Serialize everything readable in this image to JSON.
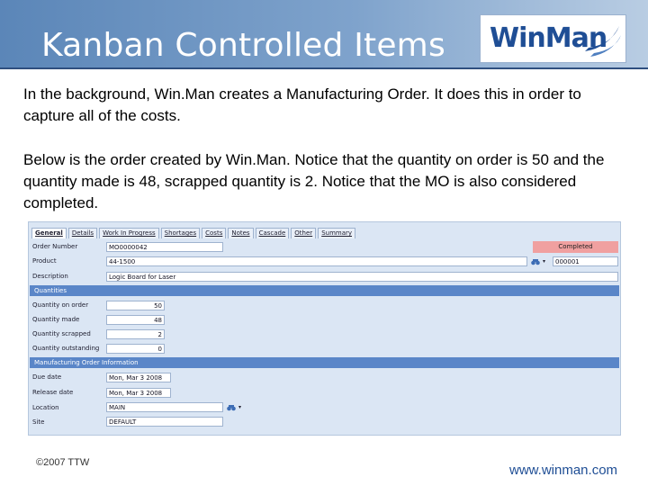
{
  "slide": {
    "title": "Kanban Controlled Items",
    "logo_text": "WinMan",
    "paragraph1": "In the background, Win.Man creates a Manufacturing Order.  It does this in order to capture all of the costs.",
    "paragraph2": "Below is the order created by Win.Man.  Notice that the quantity on order is 50 and the quantity made is 48, scrapped quantity is 2.  Notice that the MO is also considered completed.",
    "footer_left": "©2007 TTW",
    "footer_right": "www.winman.com",
    "colors": {
      "header": "#5b86b8",
      "section_bar": "#5a86c8",
      "status_badge": "#f0a0a0",
      "link": "#1f4e95"
    }
  },
  "mo_form": {
    "tabs": [
      "General",
      "Details",
      "Work In Progress",
      "Shortages",
      "Costs",
      "Notes",
      "Cascade",
      "Other",
      "Summary"
    ],
    "order_number_label": "Order Number",
    "order_number": "MO0000042",
    "status": "Completed",
    "product_label": "Product",
    "product": "44-1500",
    "product_code": "000001",
    "description_label": "Description",
    "description": "Logic Board for Laser",
    "quantities_section": "Quantities",
    "qty_on_order_label": "Quantity on order",
    "qty_on_order": "50",
    "qty_made_label": "Quantity made",
    "qty_made": "48",
    "qty_scrapped_label": "Quantity scrapped",
    "qty_scrapped": "2",
    "qty_outstanding_label": "Quantity outstanding",
    "qty_outstanding": "0",
    "mo_info_section": "Manufacturing Order Information",
    "due_date_label": "Due date",
    "due_date": "Mon, Mar 3 2008",
    "release_date_label": "Release date",
    "release_date": "Mon, Mar 3 2008",
    "location_label": "Location",
    "location": "MAIN",
    "site_label": "Site",
    "site": "DEFAULT",
    "icons": {
      "lookup": "binoculars-icon",
      "dropdown": "chevron-down-icon"
    }
  }
}
